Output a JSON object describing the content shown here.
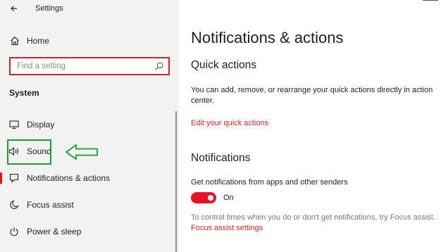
{
  "window": {
    "title": "Settings"
  },
  "sidebar": {
    "home_label": "Home",
    "search_placeholder": "Find a setting",
    "section_heading": "System",
    "items": [
      {
        "label": "Display",
        "icon": "monitor-icon"
      },
      {
        "label": "Sound",
        "icon": "speaker-icon"
      },
      {
        "label": "Notifications & actions",
        "icon": "notification-icon",
        "active": true
      },
      {
        "label": "Focus assist",
        "icon": "moon-icon"
      },
      {
        "label": "Power & sleep",
        "icon": "power-icon"
      }
    ]
  },
  "main": {
    "title": "Notifications & actions",
    "quick_actions": {
      "heading": "Quick actions",
      "description": "You can add, remove, or rearrange your quick actions directly in action center.",
      "link": "Edit your quick actions"
    },
    "notifications": {
      "heading": "Notifications",
      "toggle_label": "Get notifications from apps and other senders",
      "toggle_state": "On",
      "focus_text": "To control times when you do or don't get notifications, try Focus assist.",
      "focus_link": "Focus assist settings"
    }
  },
  "colors": {
    "accent": "#e81123",
    "link": "#c62828",
    "annotation": "#1a9e30",
    "sidebar_bg": "#f2f2f2"
  }
}
